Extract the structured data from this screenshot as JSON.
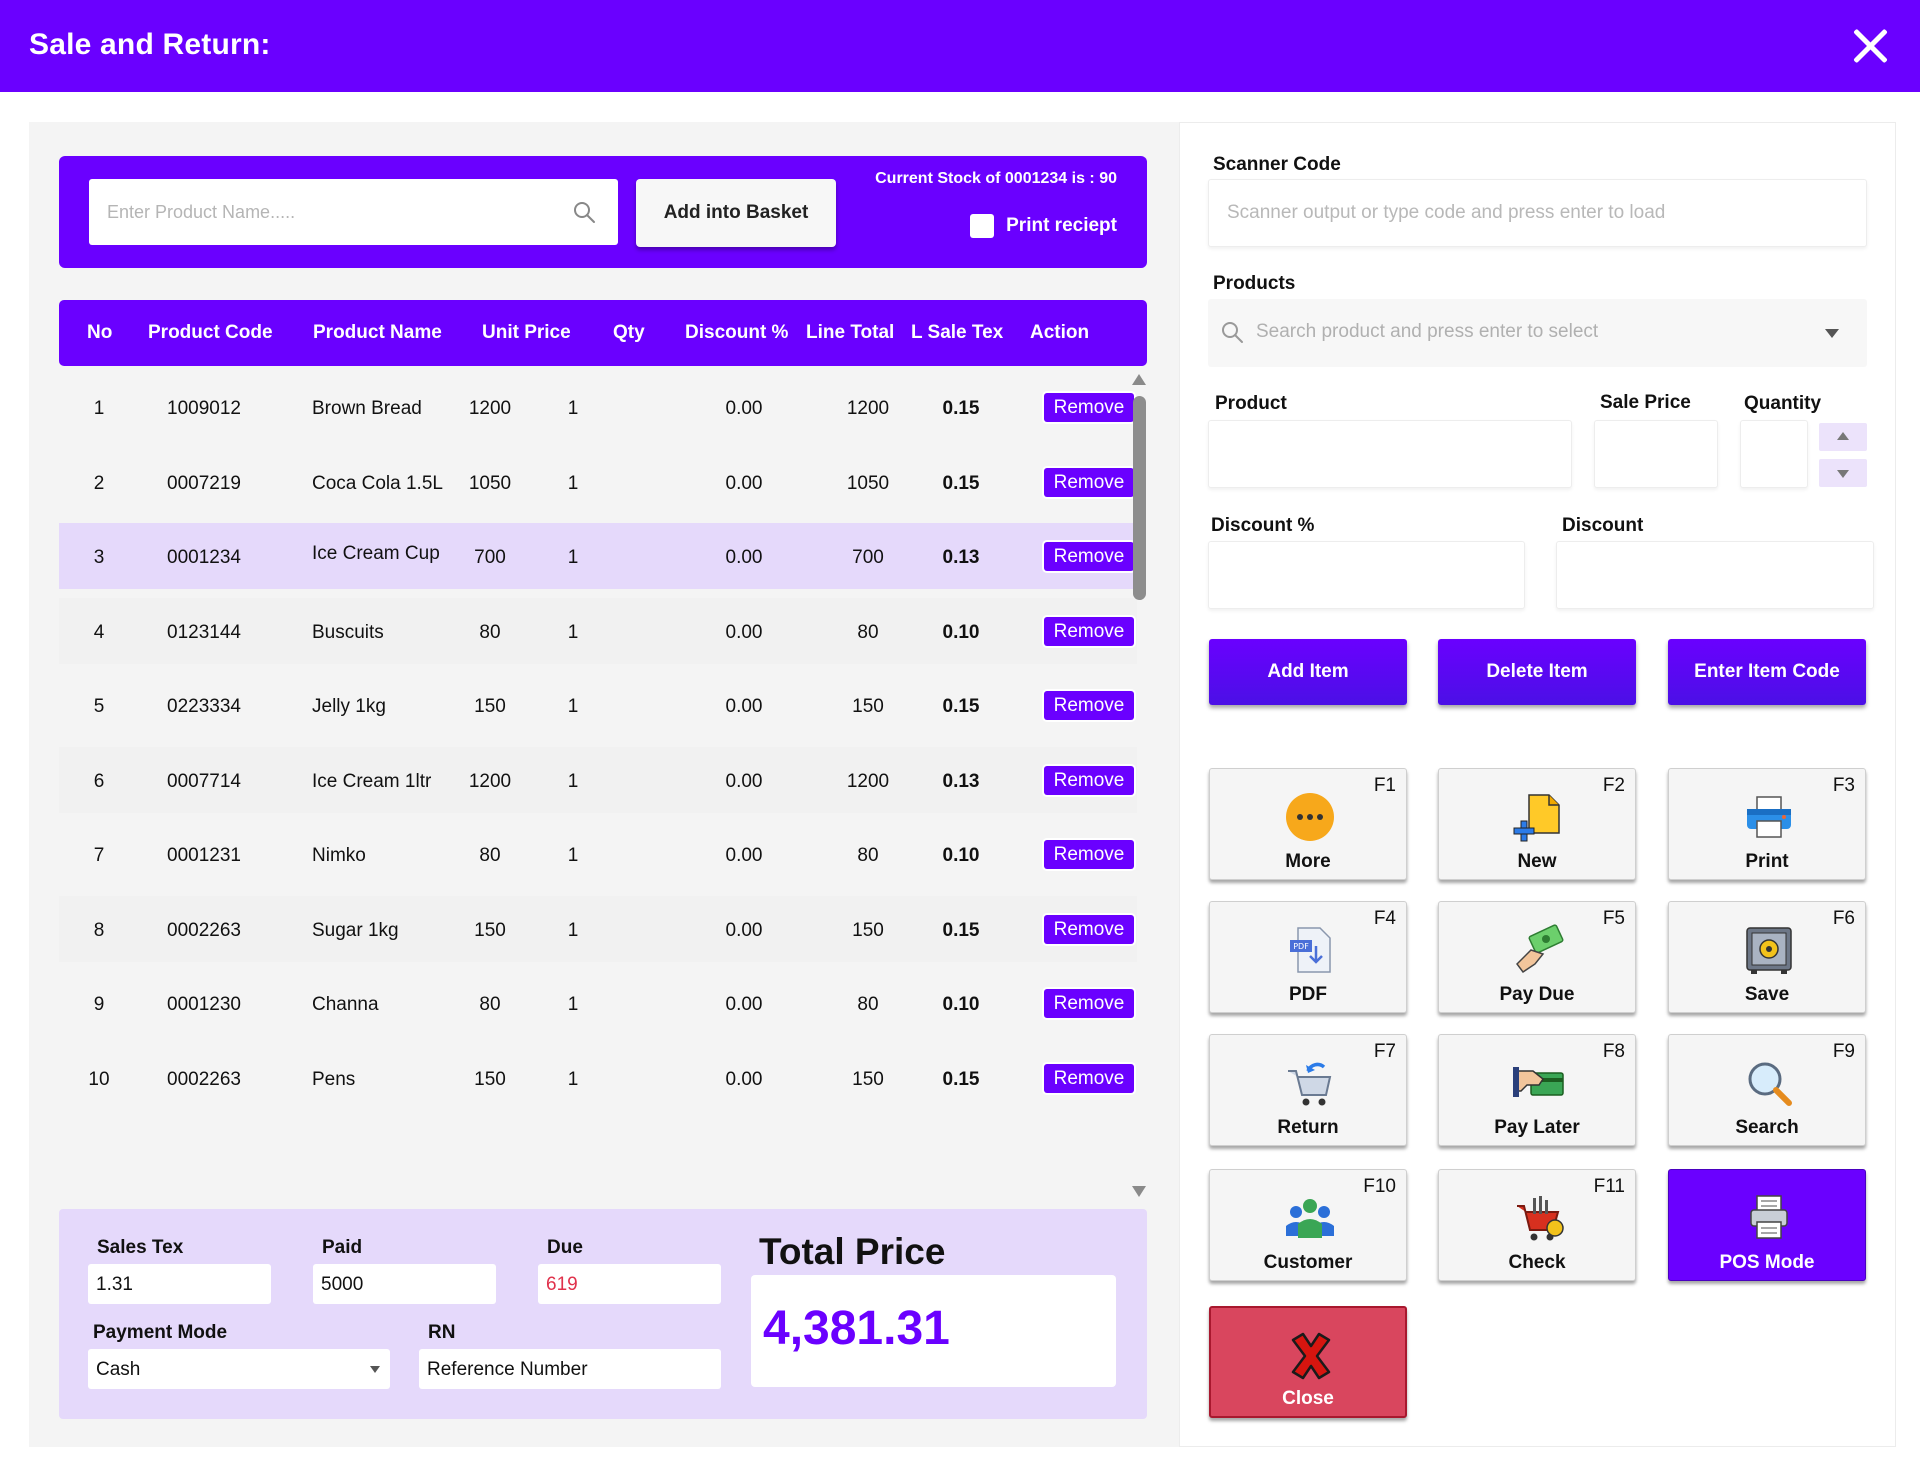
{
  "window": {
    "title": "Sale and Return:"
  },
  "search": {
    "placeholder": "Enter Product Name.....",
    "add_basket_label": "Add into Basket",
    "stock_info": "Current Stock of 0001234 is : 90",
    "print_receipt_label": "Print reciept"
  },
  "table": {
    "headers": [
      "No",
      "Product Code",
      "Product Name",
      "Unit Price",
      "Qty",
      "Discount %",
      "Line Total",
      "L Sale Tex",
      "Action"
    ],
    "remove_label": "Remove",
    "rows": [
      {
        "no": "1",
        "code": "1009012",
        "name": "Brown Bread",
        "price": "1200",
        "qty": "1",
        "disc": "0.00",
        "total": "1200",
        "tax": "0.15"
      },
      {
        "no": "2",
        "code": "0007219",
        "name": "Coca Cola 1.5L",
        "price": "1050",
        "qty": "1",
        "disc": "0.00",
        "total": "1050",
        "tax": "0.15"
      },
      {
        "no": "3",
        "code": "0001234",
        "name": "Ice Cream Cup",
        "price": "700",
        "qty": "1",
        "disc": "0.00",
        "total": "700",
        "tax": "0.13"
      },
      {
        "no": "4",
        "code": "0123144",
        "name": "Buscuits",
        "price": "80",
        "qty": "1",
        "disc": "0.00",
        "total": "80",
        "tax": "0.10"
      },
      {
        "no": "5",
        "code": "0223334",
        "name": "Jelly 1kg",
        "price": "150",
        "qty": "1",
        "disc": "0.00",
        "total": "150",
        "tax": "0.15"
      },
      {
        "no": "6",
        "code": "0007714",
        "name": "Ice Cream 1ltr",
        "price": "1200",
        "qty": "1",
        "disc": "0.00",
        "total": "1200",
        "tax": "0.13"
      },
      {
        "no": "7",
        "code": "0001231",
        "name": "Nimko",
        "price": "80",
        "qty": "1",
        "disc": "0.00",
        "total": "80",
        "tax": "0.10"
      },
      {
        "no": "8",
        "code": "0002263",
        "name": "Sugar 1kg",
        "price": "150",
        "qty": "1",
        "disc": "0.00",
        "total": "150",
        "tax": "0.15"
      },
      {
        "no": "9",
        "code": "0001230",
        "name": "Channa",
        "price": "80",
        "qty": "1",
        "disc": "0.00",
        "total": "80",
        "tax": "0.10"
      },
      {
        "no": "10",
        "code": "0002263",
        "name": "Pens",
        "price": "150",
        "qty": "1",
        "disc": "0.00",
        "total": "150",
        "tax": "0.15"
      }
    ]
  },
  "footer": {
    "sales_tex_label": "Sales Tex",
    "sales_tex_value": "1.31",
    "paid_label": "Paid",
    "paid_value": "5000",
    "due_label": "Due",
    "due_value": "619",
    "payment_mode_label": "Payment  Mode",
    "payment_mode_value": "Cash",
    "rn_label": "RN",
    "rn_value": "Reference Number",
    "total_price_label": "Total Price",
    "total_price_value": "4,381.31"
  },
  "right": {
    "scanner_label": "Scanner Code",
    "scanner_placeholder": "Scanner output or type code and press enter to load",
    "products_label": "Products",
    "products_placeholder": "Search product and press enter to select",
    "product_label": "Product",
    "sale_price_label": "Sale Price",
    "quantity_label": "Quantity",
    "discount_pct_label": "Discount %",
    "discount_label": "Discount",
    "add_item": "Add Item",
    "delete_item": "Delete Item",
    "enter_item_code": "Enter Item Code"
  },
  "fkeys": [
    {
      "key": "F1",
      "label": "More",
      "icon": "more-icon"
    },
    {
      "key": "F2",
      "label": "New",
      "icon": "new-document-icon"
    },
    {
      "key": "F3",
      "label": "Print",
      "icon": "printer-icon"
    },
    {
      "key": "F4",
      "label": "PDF",
      "icon": "pdf-icon"
    },
    {
      "key": "F5",
      "label": "Pay Due",
      "icon": "pay-due-icon"
    },
    {
      "key": "F6",
      "label": "Save",
      "icon": "safe-icon"
    },
    {
      "key": "F7",
      "label": "Return",
      "icon": "cart-return-icon"
    },
    {
      "key": "F8",
      "label": "Pay Later",
      "icon": "pay-later-icon"
    },
    {
      "key": "F9",
      "label": "Search",
      "icon": "magnifier-icon"
    },
    {
      "key": "F10",
      "label": "Customer",
      "icon": "customers-icon"
    },
    {
      "key": "F11",
      "label": "Check",
      "icon": "cart-check-icon"
    },
    {
      "key": "",
      "label": "POS Mode",
      "icon": "pos-printer-icon"
    },
    {
      "key": "",
      "label": "Close",
      "icon": "close-x-icon"
    }
  ],
  "colors": {
    "brand": "#6a00ff",
    "selected_row": "#e5d9fb",
    "due_text": "#e0314b",
    "close_button": "#d9465e"
  }
}
